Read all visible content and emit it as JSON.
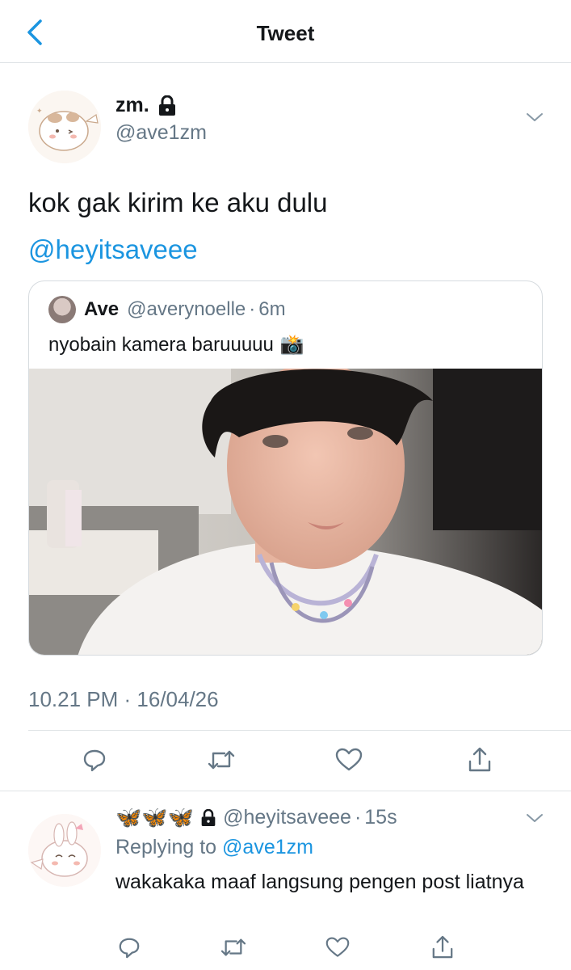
{
  "header": {
    "title": "Tweet"
  },
  "tweet": {
    "display_name": "zm.",
    "handle": "@ave1zm",
    "text": "kok gak kirim ke aku dulu",
    "mention": "@heyitsaveee",
    "timestamp": "10.21 PM · 16/04/26"
  },
  "quote": {
    "display_name": "Ave",
    "handle": "@averynoelle",
    "separator": "·",
    "time": "6m",
    "text": "nyobain kamera baruuuuu",
    "emoji": "📸"
  },
  "reply": {
    "display_name": "🦋🦋🦋",
    "handle": "@heyitsaveee",
    "separator": "·",
    "time": "15s",
    "replying_prefix": "Replying to",
    "replying_to": "@ave1zm",
    "text": "wakakaka maaf langsung pengen post liatnya"
  },
  "icons": {
    "back": "chevron-left-icon",
    "lock": "lock-icon",
    "more": "chevron-down-icon",
    "reply": "reply-icon",
    "retweet": "retweet-icon",
    "like": "heart-icon",
    "share": "share-icon"
  },
  "colors": {
    "accent": "#1b95e0",
    "secondary_text": "#657786",
    "primary_text": "#14171a",
    "divider": "#dfe3e6",
    "butterfly": "#1e8ff0"
  }
}
